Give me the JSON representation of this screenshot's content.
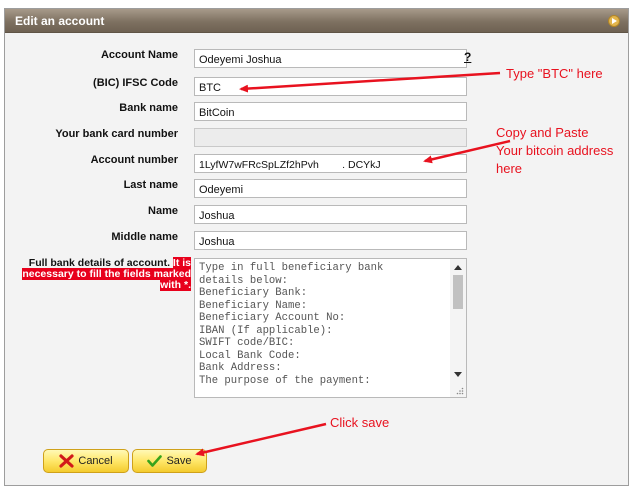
{
  "dialog": {
    "title": "Edit an account"
  },
  "form": {
    "help_mark": "?",
    "fields": [
      {
        "label": "Account Name",
        "value": "Odeyemi Joshua"
      },
      {
        "label": "(BIC) IFSC Code",
        "value": "BTC"
      },
      {
        "label": "Bank name",
        "value": "BitCoin"
      },
      {
        "label": "Your bank card number",
        "value": ""
      },
      {
        "label": "Account number",
        "value": "1LyfW7wFRcSpLZf2hPvh        . DCYkJ"
      },
      {
        "label": "Last name",
        "value": "Odeyemi"
      },
      {
        "label": "Name",
        "value": "Joshua"
      },
      {
        "label": "Middle name",
        "value": "Joshua"
      }
    ],
    "full_details_label": "Full bank details of account.",
    "required_note": "It is necessary to fill the fields marked with *.",
    "details_text": "Type in full beneficiary bank\ndetails below:\nBeneficiary Bank:\nBeneficiary Name:\nBeneficiary Account No:\nIBAN (If applicable):\nSWIFT code/BIC:\nLocal Bank Code:\nBank Address:\nThe purpose of the payment:"
  },
  "buttons": {
    "cancel": "Cancel",
    "save": "Save"
  },
  "annotations": {
    "btc_note": "Type \"BTC\" here",
    "copy_line1": "Copy and Paste",
    "copy_line2": "Your bitcoin address",
    "copy_line3": "here",
    "save_note": "Click save"
  },
  "colors": {
    "annotation": "#e8121f",
    "titlebar": "#7e7161",
    "button": "#ffe76a"
  }
}
